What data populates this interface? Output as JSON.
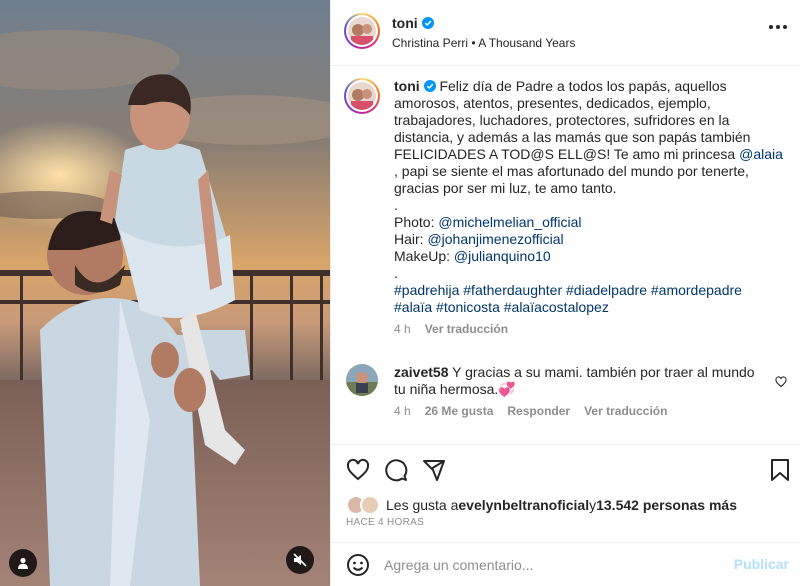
{
  "post": {
    "author": "toni",
    "song_artist": "Christina Perri",
    "song_separator": " • ",
    "song_title": "A Thousand Years",
    "more_icon": "more-horizontal-icon"
  },
  "caption": {
    "username": "toni",
    "text_1": "Feliz día de Padre a todos los papás, aquellos amorosos, atentos, presentes, dedicados, ejemplo, trabajadores, luchadores, protectores, sufridores en la distancia, y además a las mamás que son papás también FELICIDADES A TOD@S ELL@S! Te amo mi princesa ",
    "mention_daughter": "@alaia",
    "text_2": " , papi se siente el mas afortunado del mundo por tenerte, gracias por ser mi luz, te amo tanto.",
    "dot_1": ".",
    "photo_label": "Photo: ",
    "photo_mention": "@michelmelian_official",
    "hair_label": "Hair: ",
    "hair_mention": "@johanjimenezofficial",
    "makeup_label": "MakeUp: ",
    "makeup_mention": "@julianquino10",
    "dot_2": ".",
    "hashtags_line1": "#padrehija #fatherdaughter #diadelpadre #amordepadre",
    "hashtags_line2": "#alaïa #tonicosta #alaïacostalopez",
    "time": "4 h",
    "see_translation": "Ver traducción"
  },
  "comment": {
    "username": "zaivet58",
    "text": " Y gracias a su mami. también por traer al mundo tu niña hermosa.💞",
    "time": "4 h",
    "likes": "26 Me gusta",
    "reply": "Responder",
    "see_translation": "Ver traducción"
  },
  "likes": {
    "prefix": "Les gusta a ",
    "user": "evelynbeltranoficial",
    "middle": " y ",
    "count": "13.542 personas más"
  },
  "time_ago": "HACE 4 HORAS",
  "add_comment": {
    "placeholder": "Agrega un comentario...",
    "post_label": "Publicar"
  },
  "colors": {
    "link": "#00376b",
    "verified": "#0095f6",
    "post_disabled": "#b2dffc"
  }
}
